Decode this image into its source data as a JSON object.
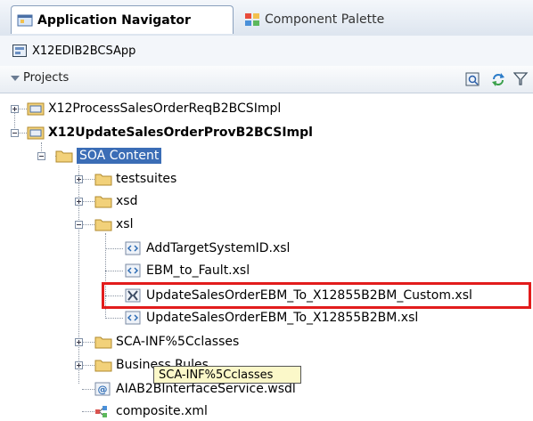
{
  "tabs": [
    {
      "label": "Application Navigator",
      "icon": "application-navigator-icon"
    },
    {
      "label": "Component Palette",
      "icon": "component-palette-icon"
    }
  ],
  "app_selector": {
    "value": "X12EDIB2BCSApp",
    "icon": "application-icon"
  },
  "projects_panel": {
    "label": "Projects",
    "toolbar_icons": [
      "project-properties-icon",
      "refresh-icon",
      "filter-icon"
    ]
  },
  "tree": {
    "project1": "X12ProcessSalesOrderReqB2BCSImpl",
    "project2": "X12UpdateSalesOrderProvB2BCSImpl",
    "soa_content": "SOA Content",
    "testsuites": "testsuites",
    "xsd": "xsd",
    "xsl": "xsl",
    "xsl_files": [
      "AddTargetSystemID.xsl",
      "EBM_to_Fault.xsl",
      "UpdateSalesOrderEBM_To_X12855B2BM_Custom.xsl",
      "UpdateSalesOrderEBM_To_X12855B2BM.xsl"
    ],
    "sca_inf": "SCA-INF%5Cclasses",
    "business_rules": "Business Rules",
    "wsdl": "AIAB2BInterfaceService.wsdl",
    "composite": "composite.xml"
  },
  "tooltip": "SCA-INF%5Cclasses",
  "colors": {
    "highlight": "#e21c1c",
    "selection": "#3b6db6",
    "folder": "#f2d17a"
  }
}
